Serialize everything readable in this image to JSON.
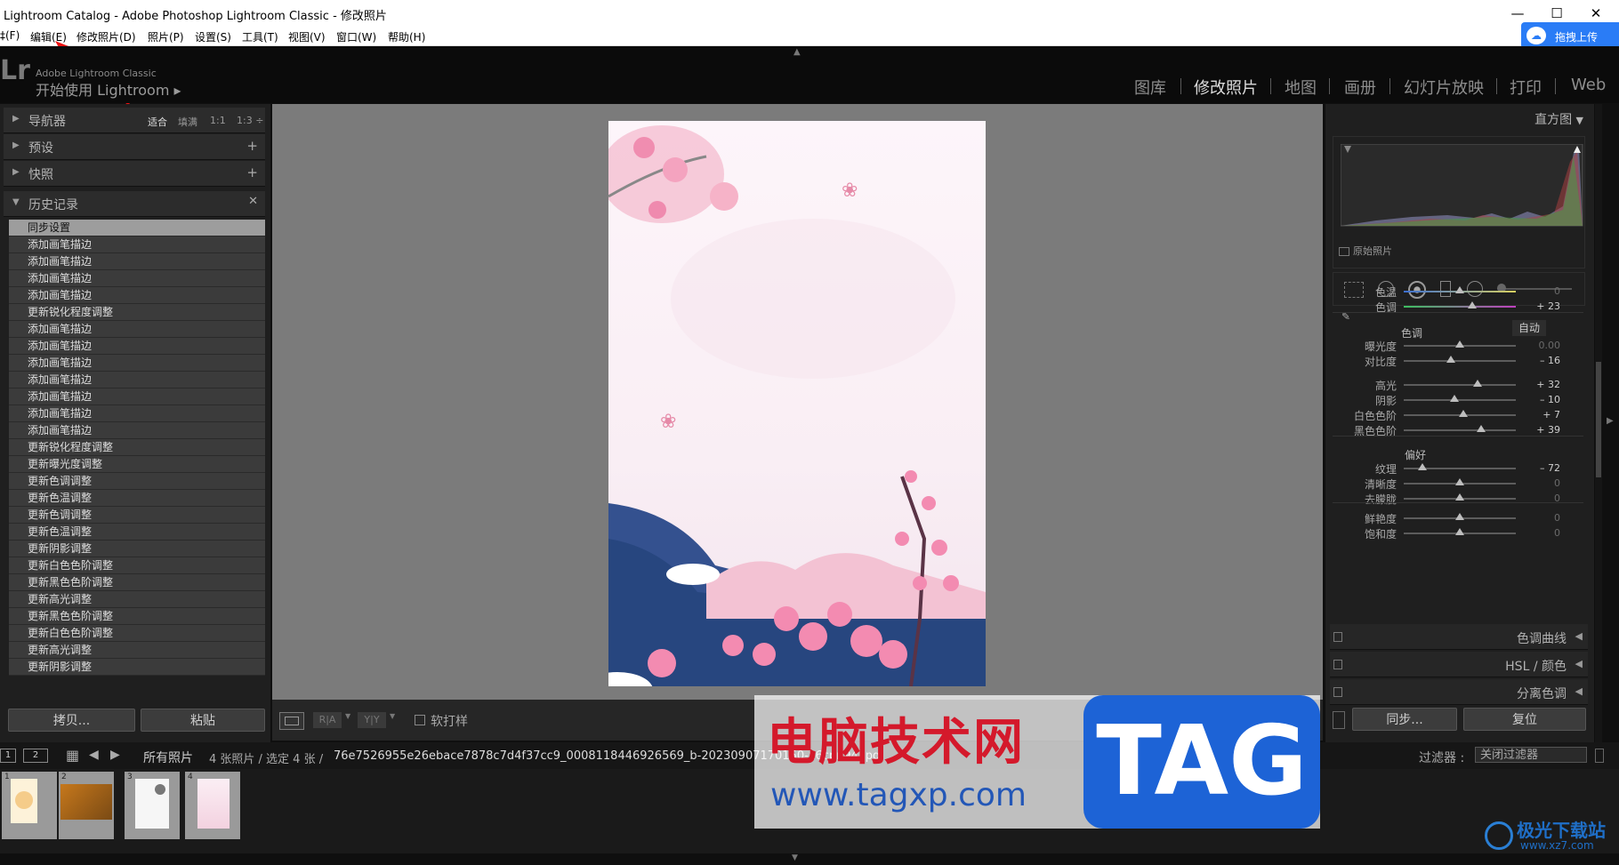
{
  "window": {
    "title": "Lightroom Catalog - Adobe Photoshop Lightroom Classic - 修改照片",
    "minimize": "—",
    "maximize": "☐",
    "close": "✕"
  },
  "menu": [
    "‡(F)",
    "编辑(E)",
    "修改照片(D)",
    "照片(P)",
    "设置(S)",
    "工具(T)",
    "视图(V)",
    "窗口(W)",
    "帮助(H)"
  ],
  "baidu_upload": "拖拽上传",
  "identity": {
    "logo": "Lr",
    "app_line": "Adobe Lightroom Classic",
    "start_line": "开始使用 Lightroom ▸"
  },
  "modules": [
    "图库",
    "修改照片",
    "地图",
    "画册",
    "幻灯片放映",
    "打印",
    "Web"
  ],
  "active_module": "修改照片",
  "left_panel": {
    "navigator": {
      "title": "导航器",
      "zoom": [
        "适合",
        "填满",
        "1:1",
        "1:3 ÷"
      ]
    },
    "presets": {
      "title": "预设",
      "action": "+"
    },
    "snapshots": {
      "title": "快照",
      "action": "+"
    },
    "history": {
      "title": "历史记录",
      "action": "✕",
      "items": [
        "同步设置",
        "添加画笔描边",
        "添加画笔描边",
        "添加画笔描边",
        "添加画笔描边",
        "更新锐化程度调整",
        "添加画笔描边",
        "添加画笔描边",
        "添加画笔描边",
        "添加画笔描边",
        "添加画笔描边",
        "添加画笔描边",
        "添加画笔描边",
        "更新锐化程度调整",
        "更新曝光度调整",
        "更新色调调整",
        "更新色温调整",
        "更新色调调整",
        "更新色温调整",
        "更新阴影调整",
        "更新白色色阶调整",
        "更新黑色色阶调整",
        "更新高光调整",
        "更新黑色色阶调整",
        "更新白色色阶调整",
        "更新高光调整",
        "更新阴影调整"
      ]
    },
    "copy_button": "拷贝...",
    "paste_button": "粘贴"
  },
  "toolbar": {
    "view_ra": "R|A",
    "view_yy": "Y|Y",
    "softproof": "软打样"
  },
  "right_panel": {
    "histogram_title": "直方图",
    "original_photo": "原始照片",
    "basic": {
      "wb": [
        {
          "label": "色温",
          "value": "0",
          "pos": 0.5
        },
        {
          "label": "色调",
          "value": "+ 23",
          "pos": 0.61
        }
      ],
      "tone_title": "色调",
      "auto": "自动",
      "tone": [
        {
          "label": "曝光度",
          "value": "0.00",
          "pos": 0.5
        },
        {
          "label": "对比度",
          "value": "– 16",
          "pos": 0.42
        },
        {
          "label": "高光",
          "value": "+ 32",
          "pos": 0.66
        },
        {
          "label": "阴影",
          "value": "– 10",
          "pos": 0.45
        },
        {
          "label": "白色色阶",
          "value": "+ 7",
          "pos": 0.53
        },
        {
          "label": "黑色色阶",
          "value": "+ 39",
          "pos": 0.69
        }
      ],
      "presence_title": "偏好",
      "presence": [
        {
          "label": "纹理",
          "value": "– 72",
          "pos": 0.17
        },
        {
          "label": "清晰度",
          "value": "0",
          "pos": 0.5
        },
        {
          "label": "去朦胧",
          "value": "0",
          "pos": 0.5
        },
        {
          "label": "鲜艳度",
          "value": "0",
          "pos": 0.5
        },
        {
          "label": "饱和度",
          "value": "0",
          "pos": 0.5
        }
      ]
    },
    "collapsed": [
      "色调曲线",
      "HSL / 颜色",
      "分离色调"
    ],
    "sync_button": "同步...",
    "reset_button": "复位"
  },
  "filmbar": {
    "screen1": "1",
    "screen2": "2",
    "source": "所有照片",
    "info": "4 张照片 / 选定 4 张 /",
    "filename": "76e7526955e26ebace7878c7d4f37cc9_0008118446926569_b-20230907170150-x6cpn94.jpg",
    "filter_label": "过滤器 :",
    "filter_value": "关闭过滤器"
  },
  "thumbs": [
    "1",
    "2",
    "3",
    "4"
  ],
  "watermark": {
    "big": "电脑技术网",
    "url": "www.tagxp.com",
    "tag": "TAG"
  },
  "corner_logo": {
    "line1": "极光下载站",
    "line2": "www.xz7.com"
  },
  "colors": {
    "accent_blue": "#2a7cf6",
    "lr_bg": "#1f1f1f",
    "active_text": "#dcdcdc",
    "watermark_red": "#d4192b",
    "tag_blue": "#1d63d6"
  }
}
